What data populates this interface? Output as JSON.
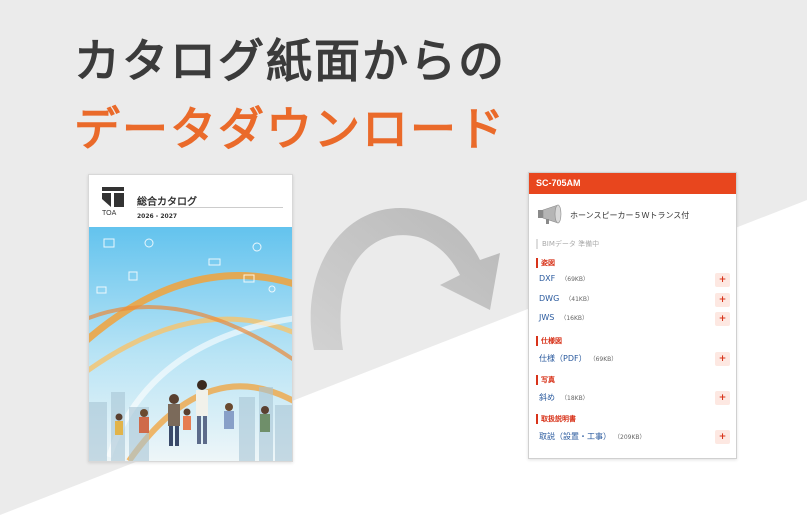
{
  "headline": {
    "line1": "カタログ紙面からの",
    "line2": "データダウンロード"
  },
  "catalog": {
    "logo_text": "TOA",
    "title": "総合カタログ",
    "year": "2026 - 2027"
  },
  "panel": {
    "model": "SC-705AM",
    "product_name": "ホーンスピーカー５Ｗトランス付",
    "bim_status": "BIMデータ 準備中",
    "sections": [
      {
        "label": "姿図",
        "files": [
          {
            "name": "DXF",
            "size": "（69KB）"
          },
          {
            "name": "DWG",
            "size": "（41KB）"
          },
          {
            "name": "JWS",
            "size": "（16KB）"
          }
        ]
      },
      {
        "label": "仕様図",
        "files": [
          {
            "name": "仕様（PDF）",
            "size": "（69KB）"
          }
        ]
      },
      {
        "label": "写真",
        "files": [
          {
            "name": "斜め",
            "size": "（18KB）"
          }
        ]
      },
      {
        "label": "取扱説明書",
        "files": [
          {
            "name": "取説（設置・工事）",
            "size": "（209KB）"
          }
        ]
      }
    ],
    "plus_label": "+"
  },
  "colors": {
    "accent": "#e8461e",
    "headline_orange": "#ea6a2a",
    "headline_dark": "#3b3b3b",
    "link": "#2a5a9e"
  }
}
